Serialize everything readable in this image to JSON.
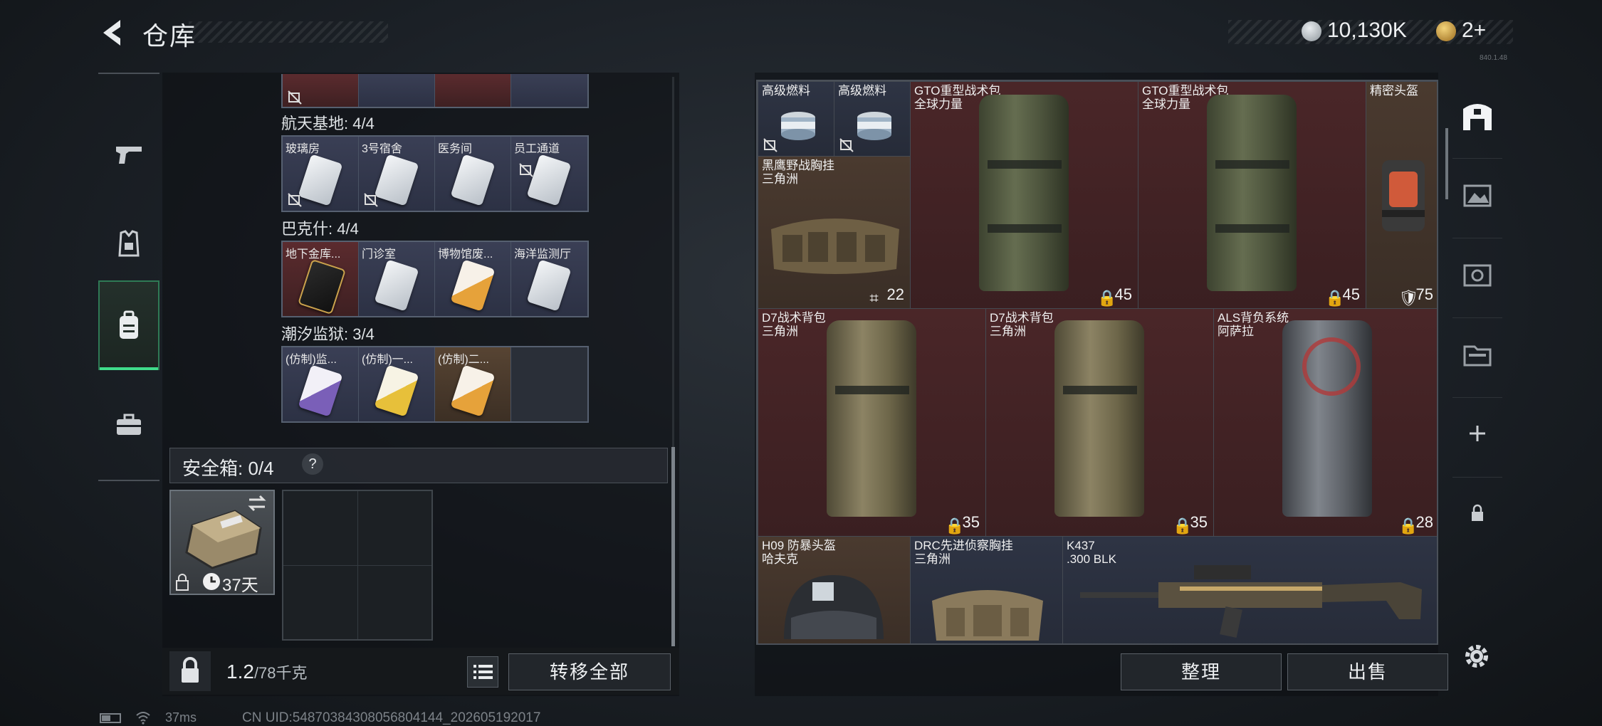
{
  "header": {
    "title": "仓库",
    "version": "840.1.48"
  },
  "currency": [
    {
      "name": "coin-silver",
      "value": "10,130K"
    },
    {
      "name": "coin-gold",
      "value": "2+"
    }
  ],
  "left_nav": [
    {
      "icon": "pistol-icon",
      "active": false
    },
    {
      "icon": "armor-vest-icon",
      "active": false
    },
    {
      "icon": "backpack-icon",
      "active": true
    },
    {
      "icon": "briefcase-icon",
      "active": false
    }
  ],
  "keycard_groups": [
    {
      "label": "航天基地: 4/4",
      "items": [
        "玻璃房",
        "3号宿舍",
        "医务间",
        "员工通道"
      ],
      "style": "purple"
    },
    {
      "label": "巴克什: 4/4",
      "items": [
        "地下金库...",
        "门诊室",
        "博物馆废...",
        "海洋监测厅"
      ],
      "style": "mixed"
    },
    {
      "label": "潮汐监狱: 3/4",
      "items": [
        "(仿制)监...",
        "(仿制)一...",
        "(仿制)二...",
        ""
      ],
      "style": "mixed"
    }
  ],
  "safebox": {
    "label": "安全箱: 0/4",
    "help": "?",
    "days": "37天"
  },
  "bottom": {
    "weight": "1.2",
    "weight_max": "/78千克",
    "transfer_all": "转移全部"
  },
  "stash": {
    "items": [
      {
        "name": "高级燃料",
        "sub": "",
        "count": ""
      },
      {
        "name": "高级燃料",
        "sub": "",
        "count": ""
      },
      {
        "name": "GTO重型战术包",
        "sub": "全球力量",
        "count": "45"
      },
      {
        "name": "GTO重型战术包",
        "sub": "全球力量",
        "count": "45"
      },
      {
        "name": "精密头盔",
        "sub": "",
        "count": "75"
      },
      {
        "name": "黑鹰野战胸挂",
        "sub": "三角洲",
        "count": "22"
      },
      {
        "name": "D7战术背包",
        "sub": "三角洲",
        "count": "35"
      },
      {
        "name": "D7战术背包",
        "sub": "三角洲",
        "count": "35"
      },
      {
        "name": "ALS背负系统",
        "sub": "阿萨拉",
        "count": "28"
      },
      {
        "name": "H09 防暴头盔",
        "sub": "哈夫克",
        "count": ""
      },
      {
        "name": "DRC先进侦察胸挂",
        "sub": "三角洲",
        "count": ""
      },
      {
        "name": "K437",
        "sub": ".300 BLK",
        "count": ""
      }
    ],
    "sort_label": "整理",
    "sell_label": "出售"
  },
  "right_nav": [
    "stash-main-icon",
    "stash-tab-2-icon",
    "stash-tab-3-icon",
    "stash-tab-4-icon",
    "add-tab-icon",
    "locked-tab-icon"
  ],
  "status": {
    "ping": "37ms",
    "uid": "CN UID:548703843080568041​44_202605192017"
  },
  "colors": {
    "accent_green": "#3fdc8a",
    "rarity_red": "#4a2628",
    "rarity_gold": "#4a3a2f",
    "rarity_purple": "#2e3444"
  }
}
